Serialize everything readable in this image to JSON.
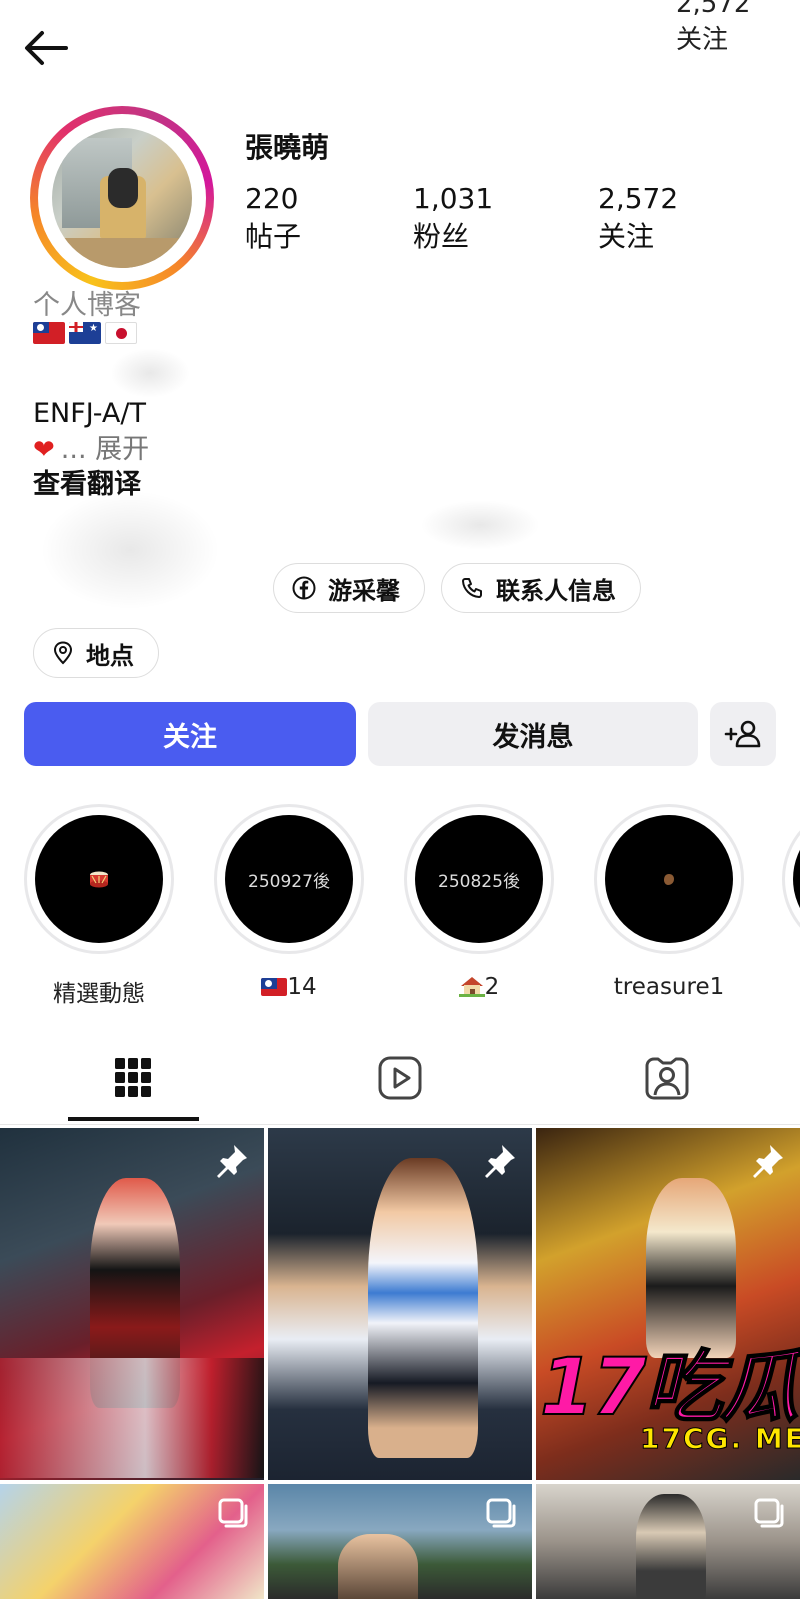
{
  "header": {
    "top_stat_value": "2,572",
    "top_stat_label": "关注"
  },
  "profile": {
    "name": "張曉萌",
    "stats": [
      {
        "value": "220",
        "label": "帖子"
      },
      {
        "value": "1,031",
        "label": "粉丝"
      },
      {
        "value": "2,572",
        "label": "关注"
      }
    ],
    "category": "个人博客",
    "bio_mbti": "ENFJ-A/T",
    "bio_more": "... 展开",
    "see_translation": "查看翻译"
  },
  "chips": {
    "facebook": "游采馨",
    "contact": "联系人信息",
    "location": "地点"
  },
  "actions": {
    "follow": "关注",
    "message": "发消息"
  },
  "highlights": [
    {
      "label": "精選動態",
      "cover_text": ""
    },
    {
      "label": "14",
      "cover_text": "250927後"
    },
    {
      "label": "2",
      "cover_text": "250825後"
    },
    {
      "label": "treasure1",
      "cover_text": ""
    }
  ],
  "watermark": {
    "big": "17吃瓜",
    "small": "17CG. ME"
  },
  "colors": {
    "accent": "#4a5cf0",
    "secondary_button": "#efeff2"
  },
  "icons": [
    "back-arrow-icon",
    "facebook-icon",
    "phone-icon",
    "location-pin-icon",
    "add-user-icon",
    "grid-icon",
    "reels-icon",
    "tagged-icon",
    "pin-icon",
    "multi-photo-icon"
  ]
}
